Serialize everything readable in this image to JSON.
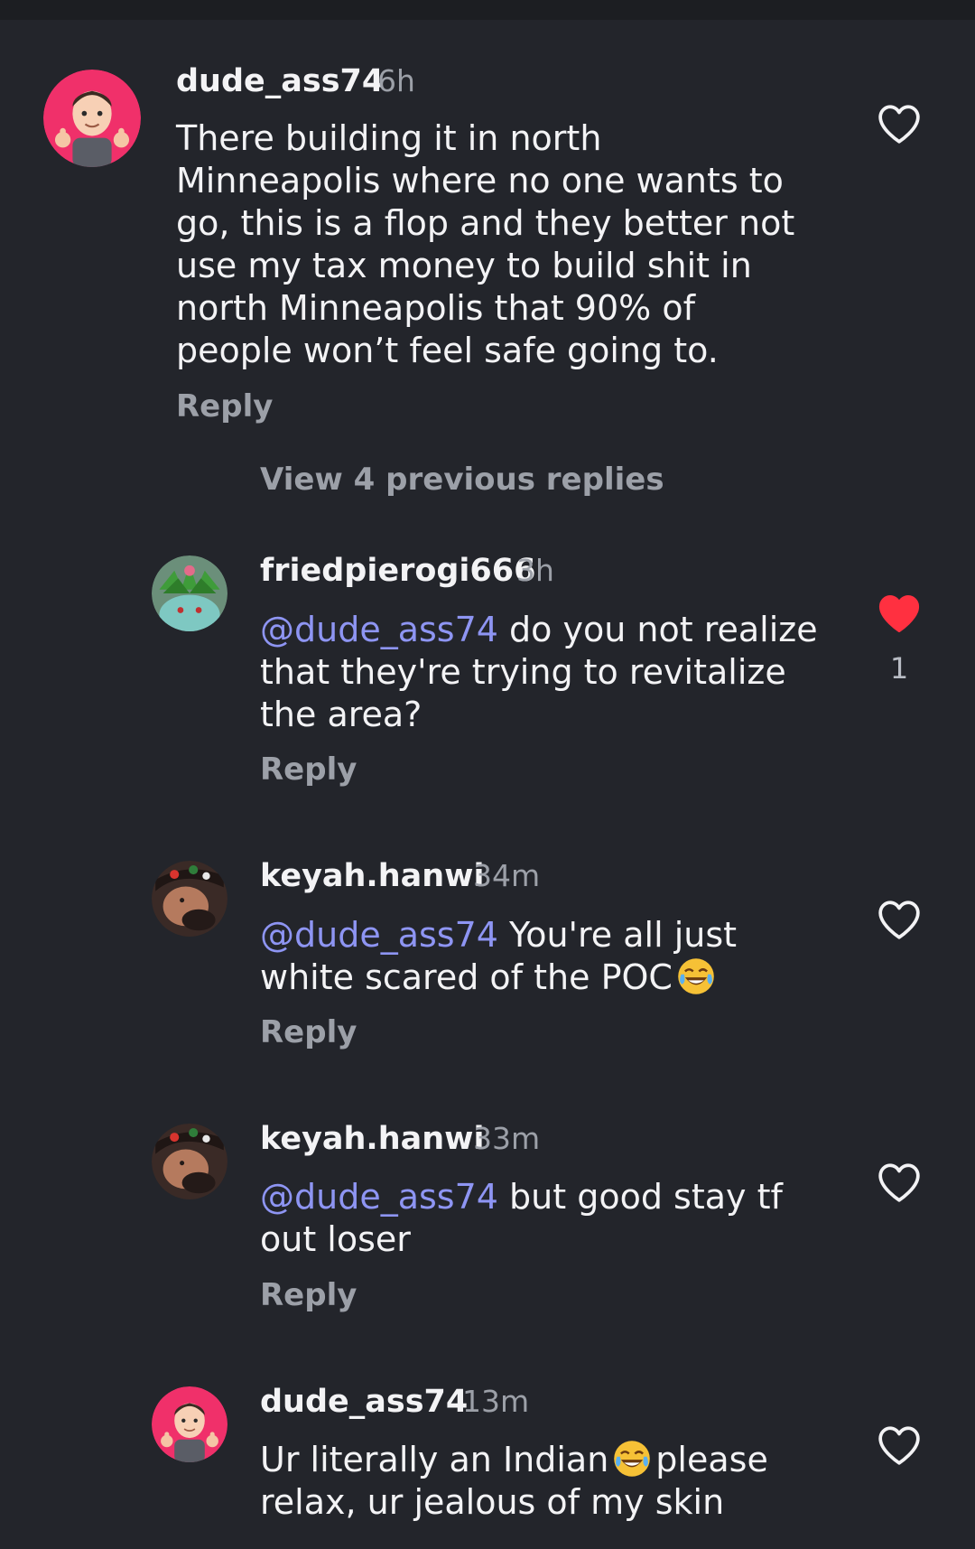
{
  "comments": [
    {
      "username": "dude_ass74",
      "time": "6h",
      "avatar_icon": "memoji-thumbs-up-avatar",
      "text_lines": [
        "There building it in north",
        "Minneapolis where no one wants to",
        "go, this is a flop and they better not",
        "use my tax money to build shit in",
        "north Minneapolis that 90% of",
        "people won’t feel safe going to."
      ],
      "reply_label": "Reply",
      "liked": false
    },
    {
      "username": "friedpierogi666",
      "time": "3h",
      "avatar_icon": "plant-creature-avatar",
      "mention": "@dude_ass74",
      "text_first": " do you not realize",
      "text_lines": [
        "that they're trying to revitalize",
        "the area?"
      ],
      "reply_label": "Reply",
      "liked": true,
      "like_count": "1"
    },
    {
      "username": "keyah.hanwi",
      "time": "34m",
      "avatar_icon": "selfie-avatar",
      "mention": "@dude_ass74",
      "text_first": " You're all just",
      "text_second": "white scared of the POC",
      "emoji": "tears-of-joy-emoji",
      "reply_label": "Reply",
      "liked": false
    },
    {
      "username": "keyah.hanwi",
      "time": "33m",
      "avatar_icon": "selfie-avatar",
      "mention": "@dude_ass74",
      "text_first": " but good stay tf",
      "text_lines": [
        "out loser"
      ],
      "reply_label": "Reply",
      "liked": false
    },
    {
      "username": "dude_ass74",
      "time": "13m",
      "avatar_icon": "memoji-thumbs-up-avatar",
      "text_first": "Ur literally an Indian",
      "emoji": "tears-of-joy-emoji",
      "text_first_after": "please",
      "text_lines": [
        "relax, ur jealous of my skin"
      ],
      "liked": false
    }
  ],
  "view_replies_label": "View 4 previous replies",
  "colors": {
    "background": "#23252b",
    "mention": "#8e95f3",
    "muted": "#9ca0a8",
    "like_red": "#ff3040",
    "avatar_pink": "#f0306a"
  }
}
